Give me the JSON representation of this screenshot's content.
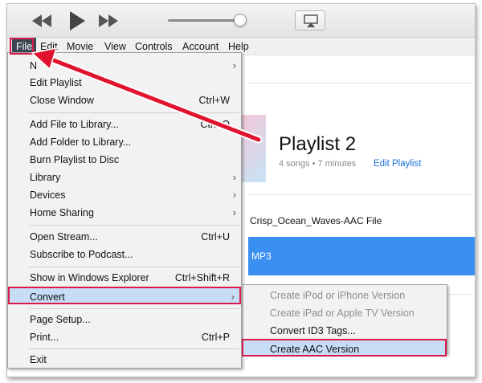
{
  "menubar": {
    "items": [
      "File",
      "Edit",
      "Movie",
      "View",
      "Controls",
      "Account",
      "Help"
    ]
  },
  "playlist": {
    "title": "Playlist 2",
    "meta": "4 songs • 7 minutes",
    "edit_link": "Edit Playlist",
    "track_name": "Crisp_Ocean_Waves-AAC File",
    "selected_track": "MP3"
  },
  "file_menu": {
    "items": [
      {
        "label": "N",
        "shortcut": "",
        "submenu": true
      },
      {
        "label": "Edit Playlist",
        "shortcut": "",
        "submenu": false
      },
      {
        "label": "Close Window",
        "shortcut": "Ctrl+W",
        "submenu": false
      },
      {
        "label": "Add File to Library...",
        "shortcut": "Ctrl+O",
        "submenu": false
      },
      {
        "label": "Add Folder to Library...",
        "shortcut": "",
        "submenu": false
      },
      {
        "label": "Burn Playlist to Disc",
        "shortcut": "",
        "submenu": false
      },
      {
        "label": "Library",
        "shortcut": "",
        "submenu": true
      },
      {
        "label": "Devices",
        "shortcut": "",
        "submenu": true
      },
      {
        "label": "Home Sharing",
        "shortcut": "",
        "submenu": true
      },
      {
        "label": "Open Stream...",
        "shortcut": "Ctrl+U",
        "submenu": false
      },
      {
        "label": "Subscribe to Podcast...",
        "shortcut": "",
        "submenu": false
      },
      {
        "label": "Show in Windows Explorer",
        "shortcut": "Ctrl+Shift+R",
        "submenu": false
      },
      {
        "label": "Convert",
        "shortcut": "",
        "submenu": true
      },
      {
        "label": "Page Setup...",
        "shortcut": "",
        "submenu": false
      },
      {
        "label": "Print...",
        "shortcut": "Ctrl+P",
        "submenu": false
      },
      {
        "label": "Exit",
        "shortcut": "",
        "submenu": false
      }
    ]
  },
  "convert_menu": {
    "items": [
      {
        "label": "Create iPod or iPhone Version",
        "enabled": false
      },
      {
        "label": "Create iPad or Apple TV Version",
        "enabled": false
      },
      {
        "label": "Convert ID3 Tags...",
        "enabled": true
      },
      {
        "label": "Create AAC Version",
        "enabled": true
      }
    ]
  },
  "colors": {
    "highlight_border": "#d81b4b",
    "highlight_fill": "#c7dcf5",
    "selection_blue": "#3b8ff0",
    "link_blue": "#1a6fd8"
  },
  "icons": {
    "rewind": "rewind-icon",
    "play": "play-icon",
    "fast_forward": "fast-forward-icon",
    "airplay": "airplay-icon",
    "submenu_arrow": "chevron-right-icon"
  }
}
